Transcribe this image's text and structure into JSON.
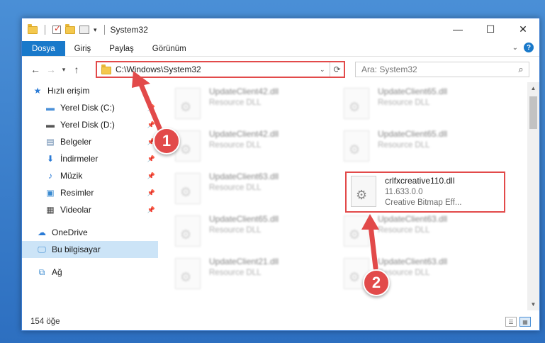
{
  "window": {
    "title": "System32",
    "controls": {
      "minimize": "—",
      "maximize": "☐",
      "close": "✕"
    }
  },
  "ribbon": {
    "tabs": [
      "Dosya",
      "Giriş",
      "Paylaş",
      "Görünüm"
    ],
    "help": "?"
  },
  "navigation": {
    "address": "C:\\Windows\\System32",
    "search_placeholder": "Ara: System32"
  },
  "sidebar": {
    "quick_access": "Hızlı erişim",
    "items": [
      {
        "label": "Yerel Disk (C:)",
        "icon": "drive-icon",
        "pinned": true
      },
      {
        "label": "Yerel Disk (D:)",
        "icon": "drive-icon",
        "pinned": true
      },
      {
        "label": "Belgeler",
        "icon": "documents-icon",
        "pinned": true
      },
      {
        "label": "İndirmeler",
        "icon": "download-icon",
        "pinned": true
      },
      {
        "label": "Müzik",
        "icon": "music-icon",
        "pinned": true
      },
      {
        "label": "Resimler",
        "icon": "pictures-icon",
        "pinned": true
      },
      {
        "label": "Videolar",
        "icon": "videos-icon",
        "pinned": true
      }
    ],
    "onedrive": "OneDrive",
    "this_pc": "Bu bilgisayar",
    "network": "Ağ"
  },
  "files": {
    "left": [
      {
        "name": "UpdateClient42.dll",
        "type": "Resource DLL"
      },
      {
        "name": "UpdateClient42.dll",
        "type": "Resource DLL"
      },
      {
        "name": "UpdateClient63.dll",
        "type": "Resource DLL"
      },
      {
        "name": "UpdateClient65.dll",
        "type": "Resource DLL"
      },
      {
        "name": "UpdateClient21.dll",
        "type": "Resource DLL"
      }
    ],
    "right": [
      {
        "name": "UpdateClient65.dll",
        "type": "Resource DLL"
      },
      {
        "name": "UpdateClient65.dll",
        "type": "Resource DLL"
      },
      {
        "name": "UpdateClient63.dll",
        "type": "Resource DLL"
      },
      {
        "name": "UpdateClient63.dll",
        "type": "Resource DLL"
      }
    ],
    "highlighted": {
      "name": "crlfxcreative110.dll",
      "version": "11.633.0.0",
      "description": "Creative Bitmap Eff..."
    }
  },
  "status": {
    "item_count": "154 öğe"
  },
  "annotations": {
    "step1": "1",
    "step2": "2",
    "color": "#e24a4a"
  }
}
